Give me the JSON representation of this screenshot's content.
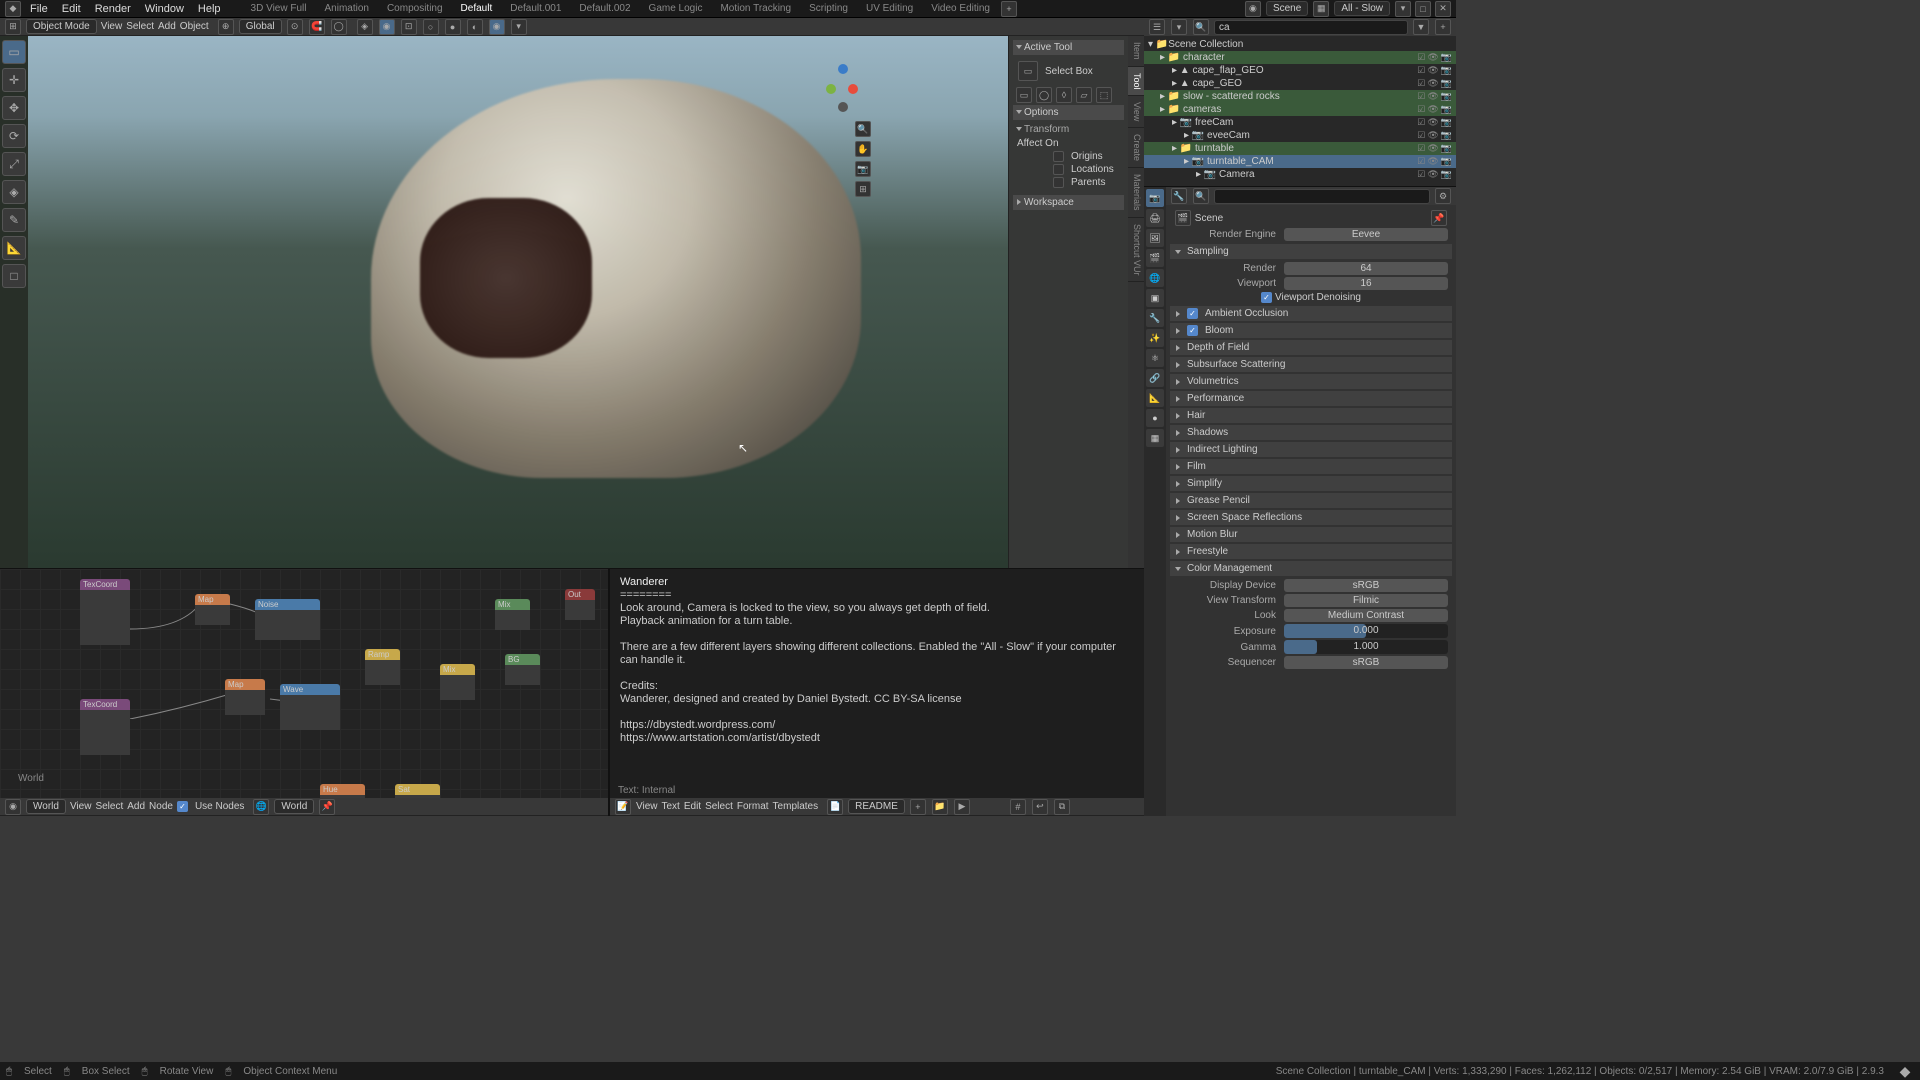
{
  "topbar": {
    "menus": [
      "File",
      "Edit",
      "Render",
      "Window",
      "Help"
    ],
    "workspaces": [
      "3D View Full",
      "Animation",
      "Compositing",
      "Default",
      "Default.001",
      "Default.002",
      "Game Logic",
      "Motion Tracking",
      "Scripting",
      "UV Editing",
      "Video Editing"
    ],
    "active_ws": "Default",
    "scene": "Scene",
    "view_layer": "All - Slow"
  },
  "vp_header": {
    "mode": "Object Mode",
    "menus": [
      "View",
      "Select",
      "Add",
      "Object"
    ],
    "orient": "Global"
  },
  "n_panel": {
    "active_tool": "Active Tool",
    "tool_name": "Select Box",
    "options": "Options",
    "transform": "Transform",
    "affect": "Affect On",
    "origins": "Origins",
    "locations": "Locations",
    "parents": "Parents",
    "workspace": "Workspace",
    "tabs": [
      "Item",
      "Tool",
      "View",
      "Create",
      "Materials",
      "Shortcut VUr"
    ]
  },
  "outliner": {
    "search": "ca",
    "root": "Scene Collection",
    "items": [
      {
        "name": "character",
        "type": "coll",
        "ind": 1
      },
      {
        "name": "cape_flap_GEO",
        "type": "obj",
        "ind": 2
      },
      {
        "name": "cape_GEO",
        "type": "obj",
        "ind": 2
      },
      {
        "name": "slow - scattered rocks",
        "type": "coll",
        "ind": 1
      },
      {
        "name": "cameras",
        "type": "coll",
        "ind": 1
      },
      {
        "name": "freeCam",
        "type": "cam",
        "ind": 2
      },
      {
        "name": "eveeCam",
        "type": "cam",
        "ind": 3
      },
      {
        "name": "turntable",
        "type": "coll",
        "ind": 2
      },
      {
        "name": "turntable_CAM",
        "type": "cam",
        "ind": 3,
        "sel": true
      },
      {
        "name": "Camera",
        "type": "cam",
        "ind": 4
      }
    ]
  },
  "props": {
    "breadcrumb": "Scene",
    "engine_lbl": "Render Engine",
    "engine": "Eevee",
    "sampling": "Sampling",
    "render_lbl": "Render",
    "render": "64",
    "viewport_lbl": "Viewport",
    "viewport": "16",
    "denoise": "Viewport Denoising",
    "panels": [
      "Ambient Occlusion",
      "Bloom",
      "Depth of Field",
      "Subsurface Scattering",
      "Volumetrics",
      "Performance",
      "Hair",
      "Shadows",
      "Indirect Lighting",
      "Film",
      "Simplify",
      "Grease Pencil",
      "Screen Space Reflections",
      "Motion Blur",
      "Freestyle",
      "Color Management"
    ],
    "checked": {
      "Ambient Occlusion": true,
      "Bloom": true
    },
    "cm": {
      "display_lbl": "Display Device",
      "display": "sRGB",
      "vt_lbl": "View Transform",
      "vt": "Filmic",
      "look_lbl": "Look",
      "look": "Medium Contrast",
      "exp_lbl": "Exposure",
      "exp": "0.000",
      "gamma_lbl": "Gamma",
      "gamma": "1.000",
      "seq_lbl": "Sequencer",
      "seq": "sRGB"
    }
  },
  "node_ed": {
    "menus": [
      "View",
      "Select",
      "Add",
      "Node"
    ],
    "use_nodes": "Use Nodes",
    "world": "World",
    "label": "World"
  },
  "text_ed": {
    "menus": [
      "View",
      "Text",
      "Edit",
      "Select",
      "Format",
      "Templates"
    ],
    "file": "README",
    "footer": "Text: Internal",
    "body_title": "Wanderer",
    "body_sep": "========",
    "body_l1": "Look around, Camera is locked to the view, so you always get depth of field.",
    "body_l2": "Playback animation for a turn table.",
    "body_l3": "There are a few different layers showing different collections. Enabled the \"All - Slow\" if your computer can handle it.",
    "body_l4": "Credits:",
    "body_l5": "Wanderer, designed and created by Daniel Bystedt. CC BY-SA license",
    "body_l6": "https://dbystedt.wordpress.com/",
    "body_l7": "https://www.artstation.com/artist/dbystedt"
  },
  "status": {
    "select": "Select",
    "box": "Box Select",
    "rotate": "Rotate View",
    "ctx": "Object Context Menu",
    "info": "Scene Collection | turntable_CAM | Verts: 1,333,290 | Faces: 1,262,112 | Objects: 0/2,517 | Memory: 2.54 GiB | VRAM: 2.0/7.9 GiB | 2.9.3"
  }
}
